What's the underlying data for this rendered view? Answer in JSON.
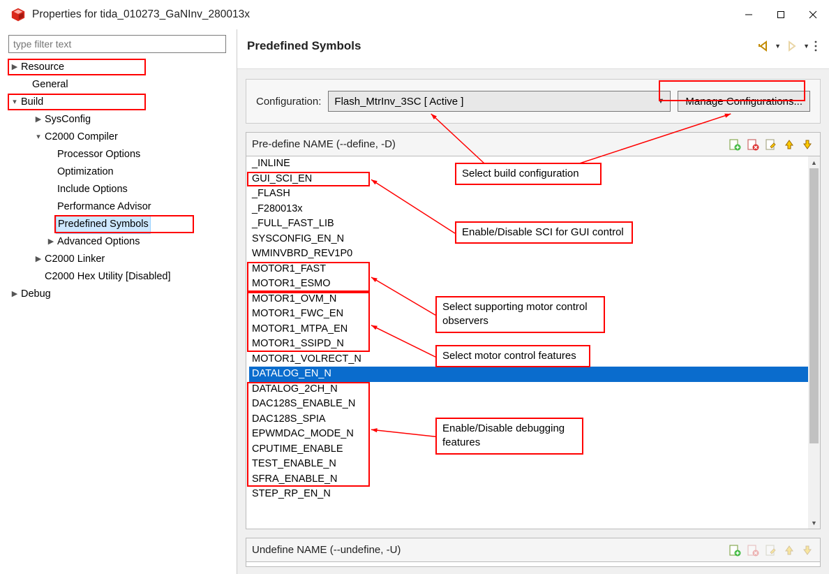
{
  "window": {
    "title": "Properties for tida_010273_GaNInv_280013x"
  },
  "filter": {
    "placeholder": "type filter text",
    "value": ""
  },
  "tree": {
    "resource": "Resource",
    "general": "General",
    "build": "Build",
    "sysconfig": "SysConfig",
    "c2000_compiler": "C2000 Compiler",
    "processor_options": "Processor Options",
    "optimization": "Optimization",
    "include_options": "Include Options",
    "performance_advisor": "Performance Advisor",
    "predefined_symbols": "Predefined Symbols",
    "advanced_options": "Advanced Options",
    "c2000_linker": "C2000 Linker",
    "c2000_hex": "C2000 Hex Utility  [Disabled]",
    "debug": "Debug"
  },
  "panel": {
    "title": "Predefined Symbols",
    "config_label": "Configuration:",
    "config_value": "Flash_MtrInv_3SC  [ Active ]",
    "manage_label": "Manage Configurations..."
  },
  "define_header": "Pre-define NAME (--define, -D)",
  "undef_header": "Undefine NAME (--undefine, -U)",
  "symbols": [
    "_INLINE",
    "GUI_SCI_EN",
    "_FLASH",
    "_F280013x",
    "_FULL_FAST_LIB",
    "SYSCONFIG_EN_N",
    "WMINVBRD_REV1P0",
    "MOTOR1_FAST",
    "MOTOR1_ESMO",
    "MOTOR1_OVM_N",
    "MOTOR1_FWC_EN",
    "MOTOR1_MTPA_EN",
    "MOTOR1_SSIPD_N",
    "MOTOR1_VOLRECT_N",
    "DATALOG_EN_N",
    "DATALOG_2CH_N",
    "DAC128S_ENABLE_N",
    "DAC128S_SPIA",
    "EPWMDAC_MODE_N",
    "CPUTIME_ENABLE",
    "TEST_ENABLE_N",
    "SFRA_ENABLE_N",
    "STEP_RP_EN_N"
  ],
  "selected_symbol": "DATALOG_EN_N",
  "annotations": {
    "a1": "Select build configuration",
    "a2": "Enable/Disable SCI for GUI control",
    "a3": "Select supporting motor control observers",
    "a4": "Select motor control features",
    "a5": "Enable/Disable debugging features"
  }
}
